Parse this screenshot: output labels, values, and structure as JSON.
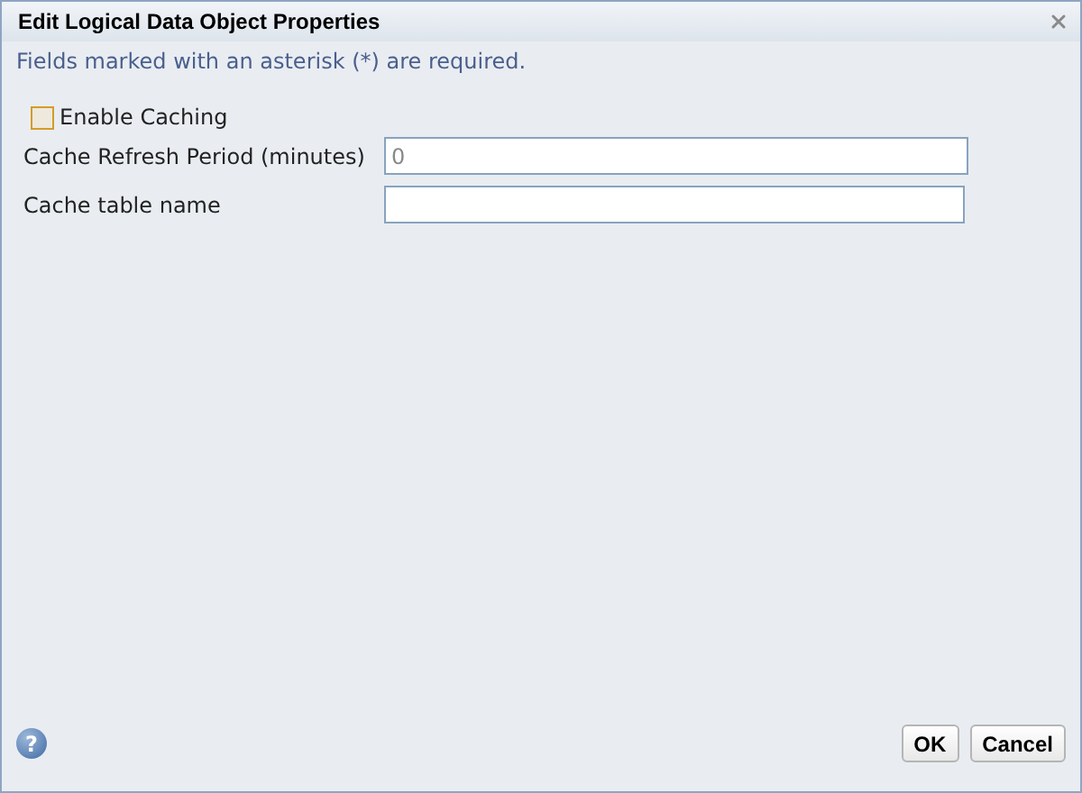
{
  "window": {
    "title": "Edit Logical Data Object Properties"
  },
  "note": "Fields marked with an asterisk (*) are required.",
  "enable_caching": {
    "label": "Enable Caching",
    "checked": false
  },
  "fields": [
    {
      "label": "Cache Refresh Period (minutes)",
      "value": "0"
    },
    {
      "label": "Cache table name"
    }
  ],
  "help": "?",
  "buttons": [
    "OK",
    "Cancel"
  ]
}
